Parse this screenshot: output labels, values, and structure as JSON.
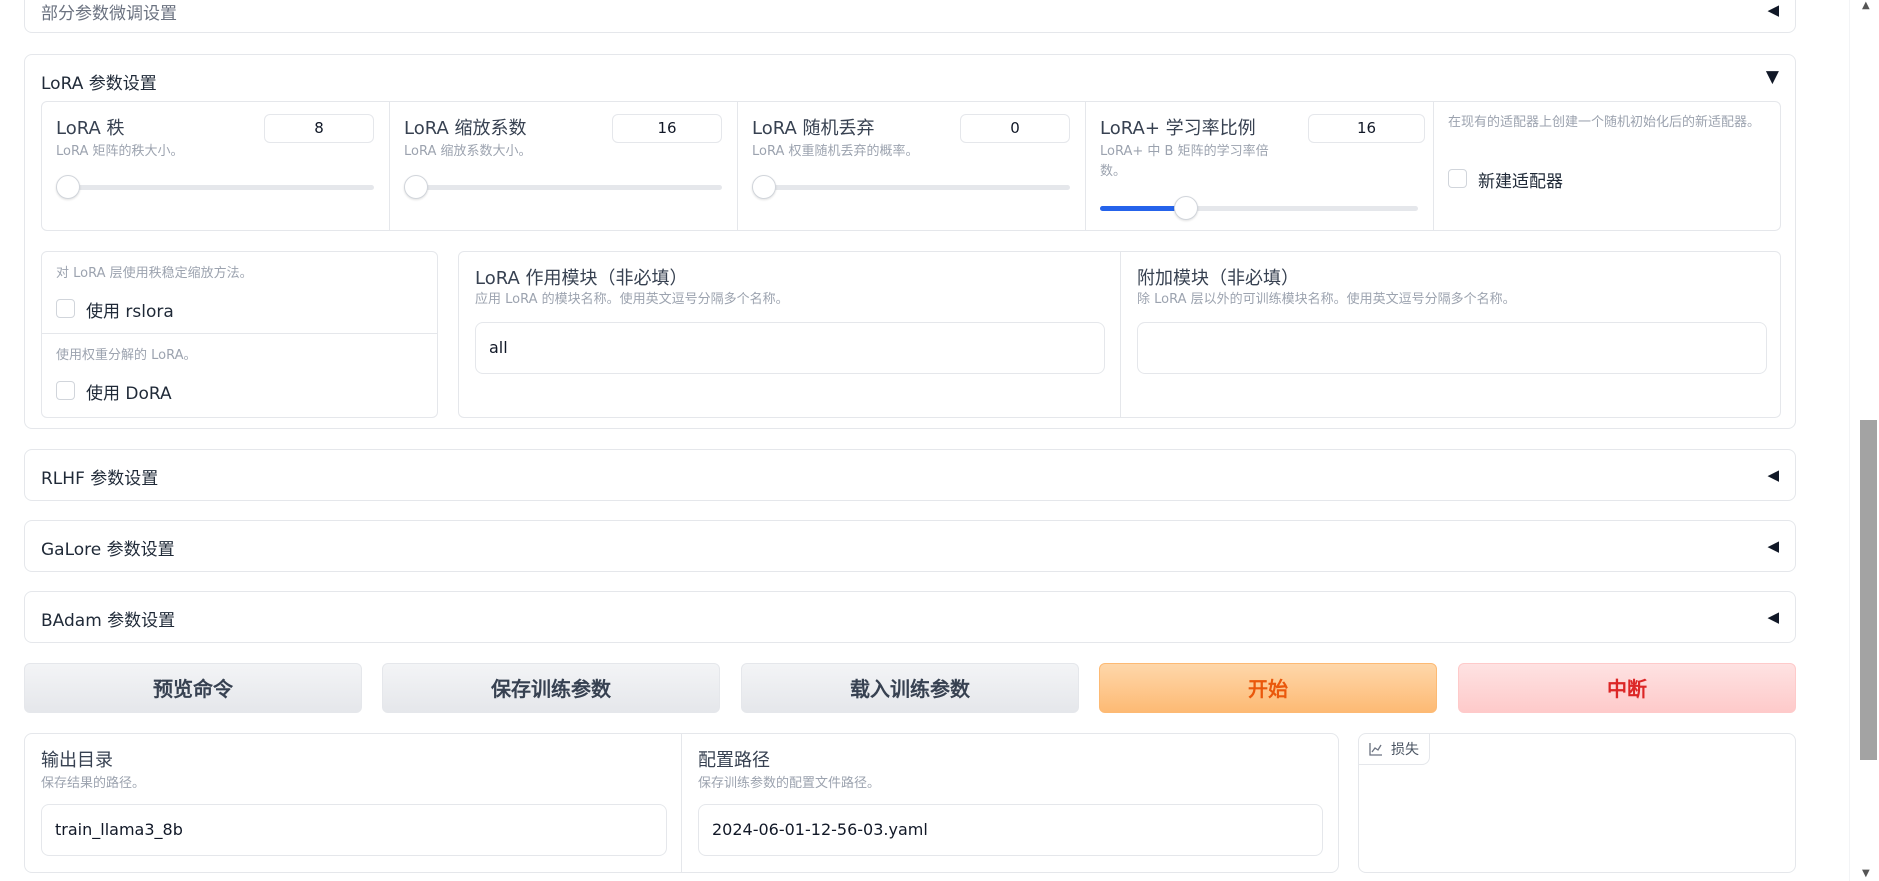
{
  "sections": {
    "partial": {
      "title": "部分参数微调设置"
    },
    "lora": {
      "title": "LoRA 参数设置"
    },
    "rlhf": {
      "title": "RLHF 参数设置"
    },
    "galore": {
      "title": "GaLore 参数设置"
    },
    "badam": {
      "title": "BAdam 参数设置"
    }
  },
  "arrows": {
    "collapsed": "◀",
    "expanded": "▼"
  },
  "lora": {
    "rank": {
      "label": "LoRA 秩",
      "desc": "LoRA 矩阵的秩大小。",
      "value": "8",
      "fraction": 0.0
    },
    "alpha": {
      "label": "LoRA 缩放系数",
      "desc": "LoRA 缩放系数大小。",
      "value": "16",
      "fraction": 0.0
    },
    "dropout": {
      "label": "LoRA 随机丢弃",
      "desc": "LoRA 权重随机丢弃的概率。",
      "value": "0",
      "fraction": 0.0
    },
    "loraplus": {
      "label": "LoRA+ 学习率比例",
      "desc": "LoRA+ 中 B 矩阵的学习率倍数。",
      "value": "16",
      "fraction": 0.27
    },
    "new_adapter": {
      "desc": "在现有的适配器上创建一个随机初始化后的新适配器。",
      "label": "新建适配器",
      "checked": false
    },
    "rslora": {
      "desc": "对 LoRA 层使用秩稳定缩放方法。",
      "label": "使用 rslora",
      "checked": false
    },
    "dora": {
      "desc": "使用权重分解的 LoRA。",
      "label": "使用 DoRA",
      "checked": false
    },
    "target": {
      "label": "LoRA 作用模块（非必填）",
      "desc": "应用 LoRA 的模块名称。使用英文逗号分隔多个名称。",
      "value": "all"
    },
    "additional": {
      "label": "附加模块（非必填）",
      "desc": "除 LoRA 层以外的可训练模块名称。使用英文逗号分隔多个名称。",
      "value": ""
    }
  },
  "buttons": {
    "preview": "预览命令",
    "save": "保存训练参数",
    "load": "载入训练参数",
    "start": "开始",
    "stop": "中断"
  },
  "output": {
    "label": "输出目录",
    "desc": "保存结果的路径。",
    "value": "train_llama3_8b"
  },
  "config": {
    "label": "配置路径",
    "desc": "保存训练参数的配置文件路径。",
    "value": "2024-06-01-12-56-03.yaml"
  },
  "loss": {
    "label": "损失",
    "icon": "chart-icon"
  },
  "scrollbar": {
    "position_fraction": 0.62
  },
  "colors": {
    "accent": "#2563eb",
    "primary_btn": "#fdba74",
    "stop_btn": "#fecaca"
  }
}
